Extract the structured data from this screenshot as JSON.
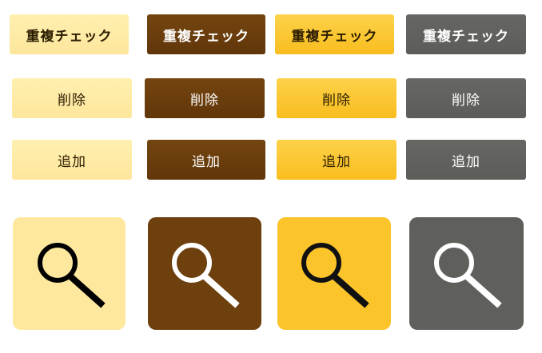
{
  "colors": {
    "pale": "#fde89e",
    "brown": "#6d400e",
    "amber": "#fbc42a",
    "gray": "#5f605c",
    "text_dark": "#2a1c00",
    "text_light": "#ffffff"
  },
  "rows": {
    "duplicate_check": {
      "label": "重複チェック",
      "variants": [
        "重複チェック",
        "重複チェック",
        "重複チェック",
        "重複チェック"
      ]
    },
    "delete": {
      "label": "削除",
      "variants": [
        "削除",
        "削除",
        "削除",
        "削除"
      ]
    },
    "add": {
      "label": "追加",
      "variants": [
        "追加",
        "追加",
        "追加",
        "追加"
      ]
    }
  },
  "search_icons": [
    {
      "theme": "pale",
      "icon": "search-icon",
      "glyph_color": "#000000"
    },
    {
      "theme": "brown",
      "icon": "search-icon",
      "glyph_color": "#ffffff"
    },
    {
      "theme": "amber",
      "icon": "search-icon",
      "glyph_color": "#111111"
    },
    {
      "theme": "gray",
      "icon": "search-icon",
      "glyph_color": "#ffffff"
    }
  ]
}
